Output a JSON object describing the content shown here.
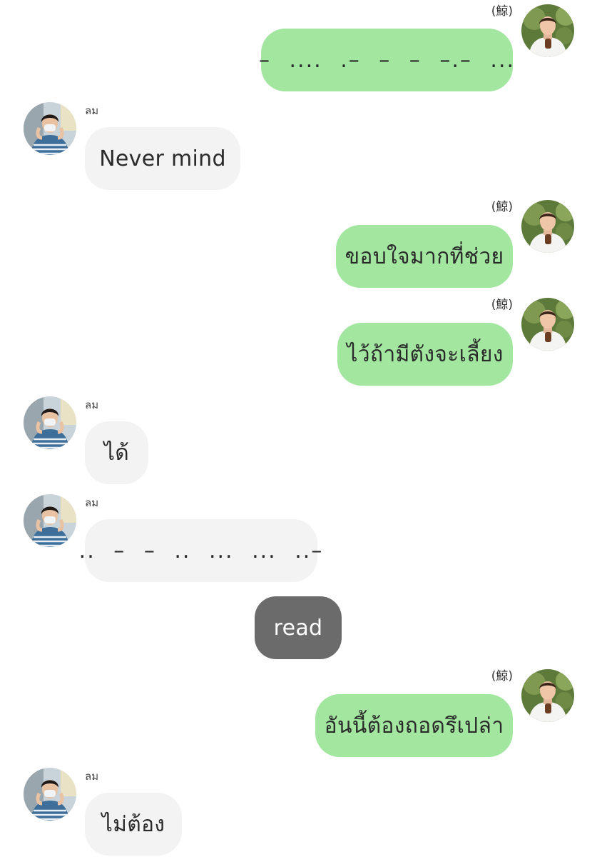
{
  "chat": {
    "messages": [
      {
        "sender": "(鯨)",
        "side": "right",
        "text": "–   ....   .–   – –   –.–   ..."
      },
      {
        "sender": "ลม",
        "side": "left",
        "text": "Never mind"
      },
      {
        "sender": "(鯨)",
        "side": "right",
        "text": "ขอบใจมากที่ช่วย"
      },
      {
        "sender": "(鯨)",
        "side": "right",
        "text": "ไว้ถ้ามีตังจะเลี้ยง"
      },
      {
        "sender": "ลม",
        "side": "left",
        "text": "ได้"
      },
      {
        "sender": "ลม",
        "side": "left",
        "text": "..   – –   ..   ...   ...   ..–"
      },
      {
        "sender": "",
        "side": "center",
        "text": "read"
      },
      {
        "sender": "(鯨)",
        "side": "right",
        "text": "อันนี้ต้องถอดรึเปล่า"
      },
      {
        "sender": "ลม",
        "side": "left",
        "text": "ไม่ต้อง"
      }
    ]
  },
  "colors": {
    "my_bubble": "#a2e6a0",
    "their_bubble": "#f3f3f3",
    "system_bubble": "#6b6b6b"
  },
  "icons": {
    "my_avatar": "avatar-photo-man-white-shirt",
    "their_avatar": "avatar-photo-man-striped-shirt-mask"
  }
}
